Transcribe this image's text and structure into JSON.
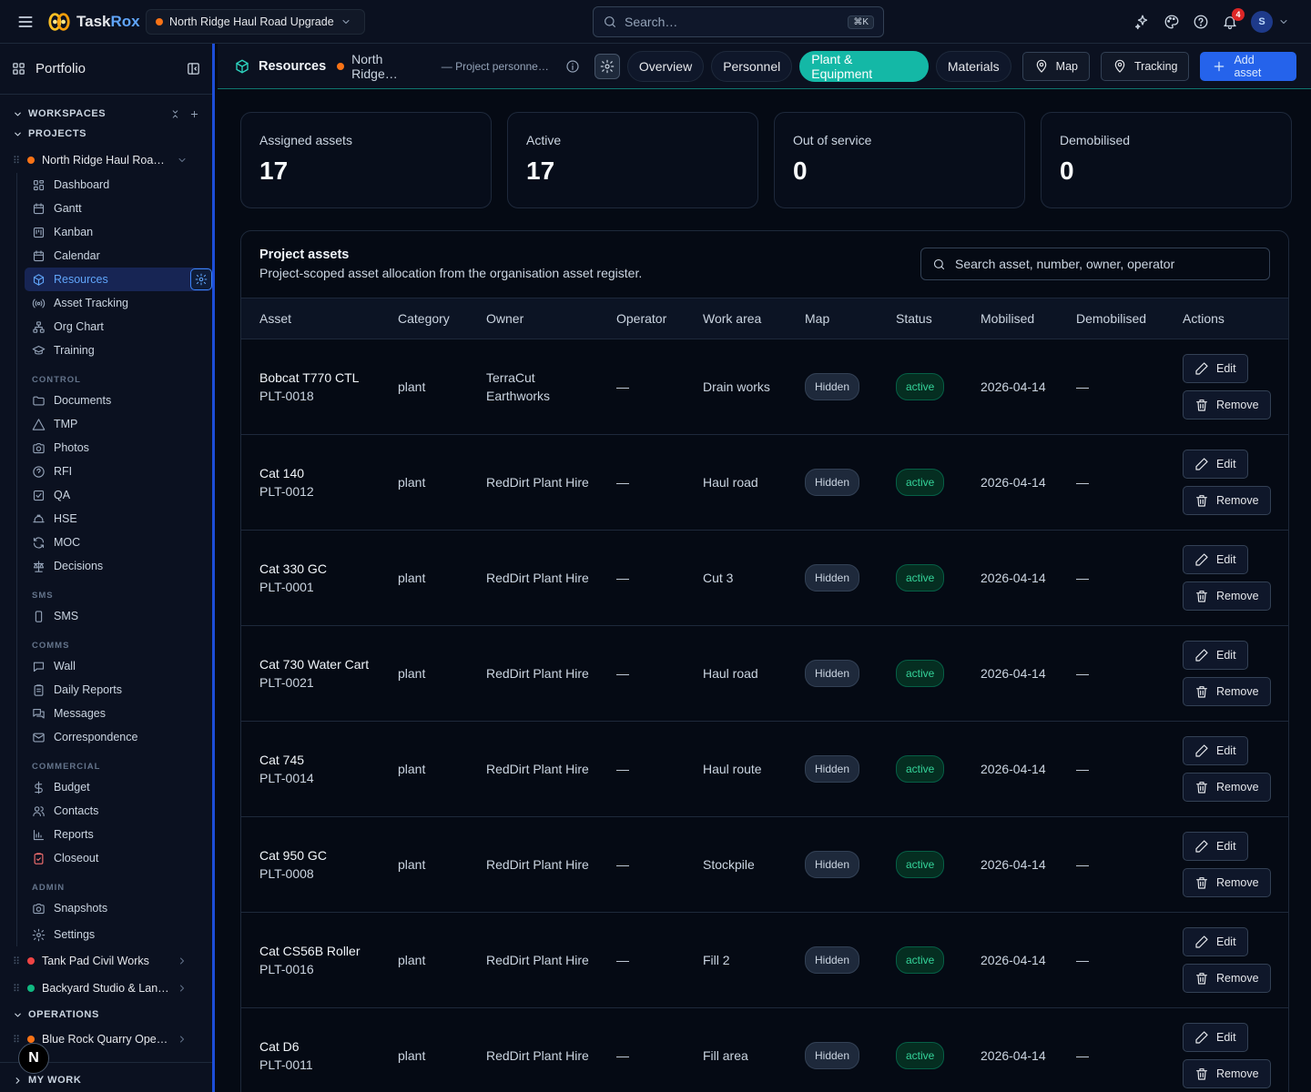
{
  "topbar": {
    "brand_prefix": "Task",
    "brand_suffix": "Rox",
    "project_name": "North Ridge Haul Road Upgrade",
    "project_color": "#f97316",
    "search_placeholder": "Search…",
    "search_shortcut": "⌘K",
    "notification_count": "4",
    "avatar_initial": "S"
  },
  "sidebar": {
    "portfolio_label": "Portfolio",
    "workspaces_label": "WORKSPACES",
    "projects_label": "PROJECTS",
    "operations_label": "OPERATIONS",
    "mywork_label": "MY WORK",
    "active_project": "North Ridge Haul Road…",
    "main_items": [
      {
        "label": "Dashboard",
        "icon": "grid-icon"
      },
      {
        "label": "Gantt",
        "icon": "gantt-icon"
      },
      {
        "label": "Kanban",
        "icon": "kanban-icon"
      },
      {
        "label": "Calendar",
        "icon": "calendar-icon"
      },
      {
        "label": "Resources",
        "icon": "cube-icon"
      },
      {
        "label": "Asset Tracking",
        "icon": "signal-icon"
      },
      {
        "label": "Org Chart",
        "icon": "org-chart-icon"
      },
      {
        "label": "Training",
        "icon": "graduation-cap-icon"
      }
    ],
    "groups": {
      "control": "CONTROL",
      "sms": "SMS",
      "comms": "COMMS",
      "commercial": "COMMERCIAL",
      "admin": "ADMIN"
    },
    "control_items": [
      "Documents",
      "TMP",
      "Photos",
      "RFI",
      "QA",
      "HSE",
      "MOC",
      "Decisions"
    ],
    "sms_items": [
      "SMS"
    ],
    "comms_items": [
      "Wall",
      "Daily Reports",
      "Messages",
      "Correspondence"
    ],
    "commercial_items": [
      "Budget",
      "Contacts",
      "Reports",
      "Closeout"
    ],
    "admin_items": [
      "Snapshots"
    ],
    "settings_label": "Settings",
    "other_projects": [
      {
        "name": "Tank Pad Civil Works",
        "color": "#ef4444"
      },
      {
        "name": "Backyard Studio & Lan…",
        "color": "#10b981"
      }
    ],
    "operations_projects": [
      {
        "name": "Blue Rock Quarry Oper…",
        "color": "#f97316"
      }
    ],
    "n_badge": "N"
  },
  "subbar": {
    "title": "Resources",
    "project_short": "North Ridge…",
    "note": "— Project personne…",
    "tabs": [
      "Overview",
      "Personnel",
      "Plant & Equipment",
      "Materials"
    ],
    "active_tab": "Plant & Equipment",
    "map_label": "Map",
    "tracking_label": "Tracking",
    "add_label": "Add asset"
  },
  "summary": [
    {
      "label": "Assigned assets",
      "value": "17"
    },
    {
      "label": "Active",
      "value": "17"
    },
    {
      "label": "Out of service",
      "value": "0"
    },
    {
      "label": "Demobilised",
      "value": "0"
    }
  ],
  "panel": {
    "title": "Project assets",
    "subtitle": "Project-scoped asset allocation from the organisation asset register.",
    "search_placeholder": "Search asset, number, owner, operator",
    "columns": [
      "Asset",
      "Category",
      "Owner",
      "Operator",
      "Work area",
      "Map",
      "Status",
      "Mobilised",
      "Demobilised",
      "Actions"
    ],
    "edit_label": "Edit",
    "remove_label": "Remove",
    "rows": [
      {
        "name": "Bobcat T770 CTL",
        "number": "PLT-0018",
        "category": "plant",
        "owner": "TerraCut Earthworks",
        "operator": "—",
        "area": "Drain works",
        "map": "Hidden",
        "status": "active",
        "mobilised": "2026-04-14",
        "demobilised": "—"
      },
      {
        "name": "Cat 140",
        "number": "PLT-0012",
        "category": "plant",
        "owner": "RedDirt Plant Hire",
        "operator": "—",
        "area": "Haul road",
        "map": "Hidden",
        "status": "active",
        "mobilised": "2026-04-14",
        "demobilised": "—"
      },
      {
        "name": "Cat 330 GC",
        "number": "PLT-0001",
        "category": "plant",
        "owner": "RedDirt Plant Hire",
        "operator": "—",
        "area": "Cut 3",
        "map": "Hidden",
        "status": "active",
        "mobilised": "2026-04-14",
        "demobilised": "—"
      },
      {
        "name": "Cat 730 Water Cart",
        "number": "PLT-0021",
        "category": "plant",
        "owner": "RedDirt Plant Hire",
        "operator": "—",
        "area": "Haul road",
        "map": "Hidden",
        "status": "active",
        "mobilised": "2026-04-14",
        "demobilised": "—"
      },
      {
        "name": "Cat 745",
        "number": "PLT-0014",
        "category": "plant",
        "owner": "RedDirt Plant Hire",
        "operator": "—",
        "area": "Haul route",
        "map": "Hidden",
        "status": "active",
        "mobilised": "2026-04-14",
        "demobilised": "—"
      },
      {
        "name": "Cat 950 GC",
        "number": "PLT-0008",
        "category": "plant",
        "owner": "RedDirt Plant Hire",
        "operator": "—",
        "area": "Stockpile",
        "map": "Hidden",
        "status": "active",
        "mobilised": "2026-04-14",
        "demobilised": "—"
      },
      {
        "name": "Cat CS56B Roller",
        "number": "PLT-0016",
        "category": "plant",
        "owner": "RedDirt Plant Hire",
        "operator": "—",
        "area": "Fill 2",
        "map": "Hidden",
        "status": "active",
        "mobilised": "2026-04-14",
        "demobilised": "—"
      },
      {
        "name": "Cat D6",
        "number": "PLT-0011",
        "category": "plant",
        "owner": "RedDirt Plant Hire",
        "operator": "—",
        "area": "Fill area",
        "map": "Hidden",
        "status": "active",
        "mobilised": "2026-04-14",
        "demobilised": "—"
      }
    ]
  }
}
